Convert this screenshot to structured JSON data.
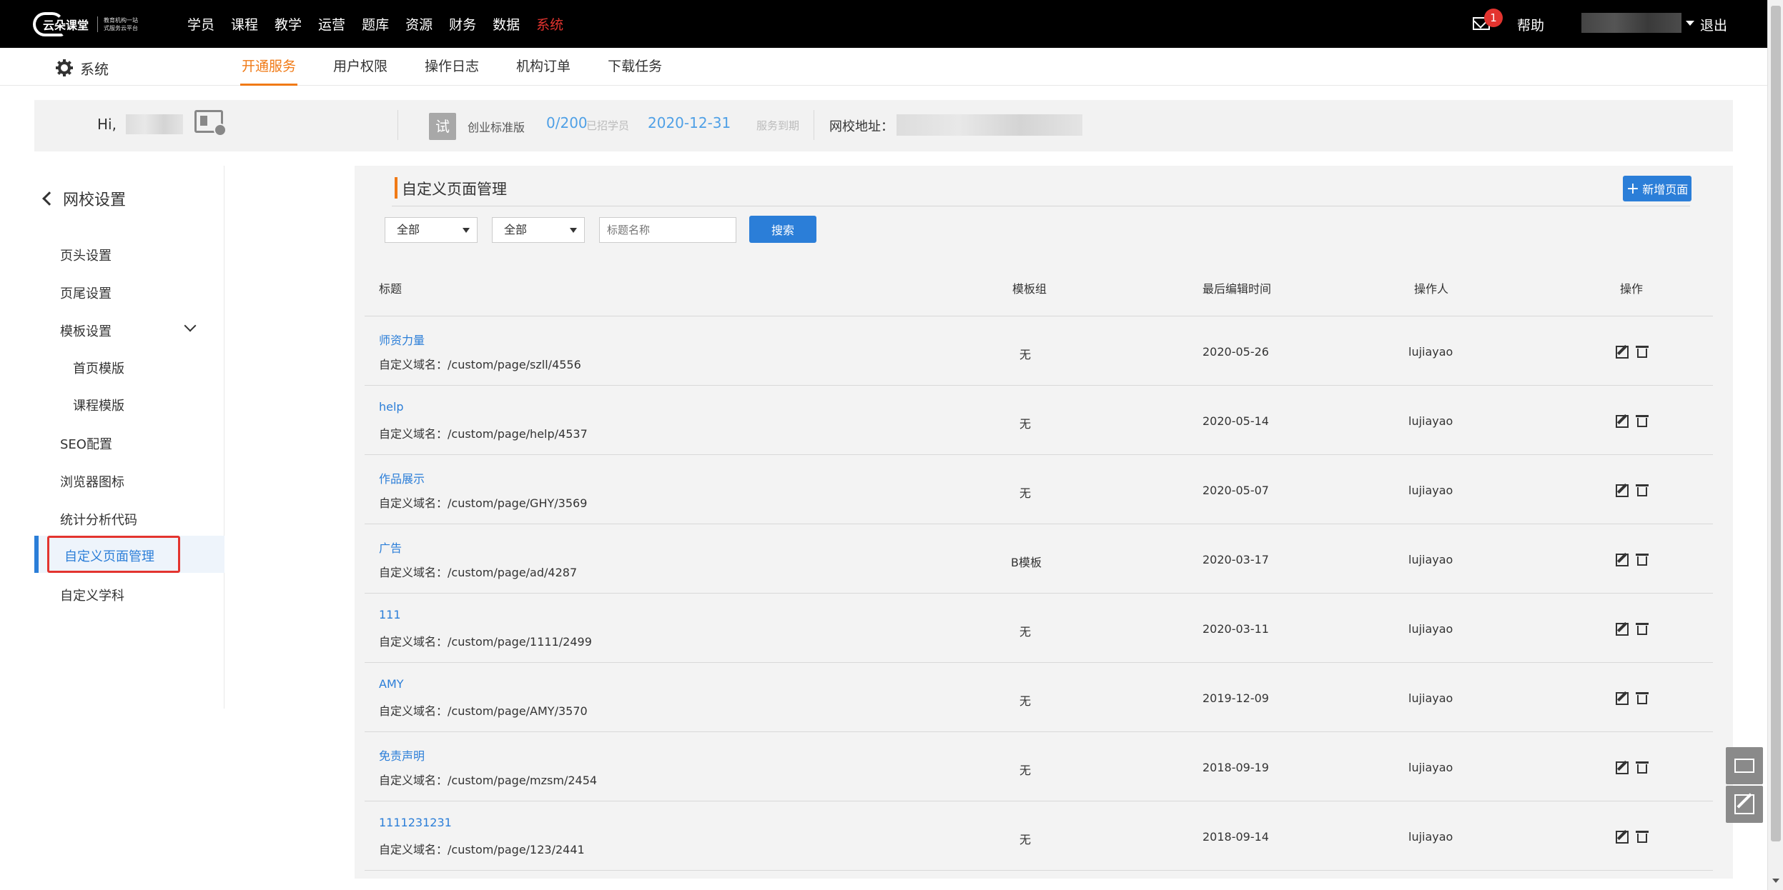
{
  "topbar": {
    "logo_text": "云朵课堂",
    "logo_sub": "教育机构一站式服务云平台",
    "nav": [
      "学员",
      "课程",
      "教学",
      "运营",
      "题库",
      "资源",
      "财务",
      "数据",
      "系统"
    ],
    "mail_count": "1",
    "help": "帮助",
    "logout": "退出"
  },
  "subbar": {
    "title": "系统",
    "tabs": [
      "开通服务",
      "用户权限",
      "操作日志",
      "机构订单",
      "下载任务"
    ]
  },
  "info": {
    "greeting": "Hi,",
    "trial_badge": "试",
    "plan": "创业标准版",
    "quota": "0/200",
    "quota_note": "已招学员",
    "expire_date": "2020-12-31",
    "expire_note": "服务到期",
    "school_url_label": "网校地址："
  },
  "sidebar": {
    "back": "网校设置",
    "items": [
      "页头设置",
      "页尾设置",
      "模板设置",
      "首页模版",
      "课程模版",
      "SEO配置",
      "浏览器图标",
      "统计分析代码",
      "自定义页面管理",
      "自定义学科"
    ]
  },
  "main": {
    "title": "自定义页面管理",
    "new_button": "新增页面",
    "filter1": "全部",
    "filter2": "全部",
    "search_placeholder": "标题名称",
    "search_button": "搜索",
    "columns": [
      "标题",
      "模板组",
      "最后编辑时间",
      "操作人",
      "操作"
    ],
    "rows": [
      {
        "title": "师资力量",
        "domain": "自定义域名：/custom/page/szll/4556",
        "group": "无",
        "date": "2020-05-26",
        "operator": "lujiayao"
      },
      {
        "title": "help",
        "domain": "自定义域名：/custom/page/help/4537",
        "group": "无",
        "date": "2020-05-14",
        "operator": "lujiayao"
      },
      {
        "title": "作品展示",
        "domain": "自定义域名：/custom/page/GHY/3569",
        "group": "无",
        "date": "2020-05-07",
        "operator": "lujiayao"
      },
      {
        "title": "广告",
        "domain": "自定义域名：/custom/page/ad/4287",
        "group": "B模板",
        "date": "2020-03-17",
        "operator": "lujiayao"
      },
      {
        "title": "111",
        "domain": "自定义域名：/custom/page/1111/2499",
        "group": "无",
        "date": "2020-03-11",
        "operator": "lujiayao"
      },
      {
        "title": "AMY",
        "domain": "自定义域名：/custom/page/AMY/3570",
        "group": "无",
        "date": "2019-12-09",
        "operator": "lujiayao"
      },
      {
        "title": "免责声明",
        "domain": "自定义域名：/custom/page/mzsm/2454",
        "group": "无",
        "date": "2018-09-19",
        "operator": "lujiayao"
      },
      {
        "title": "1111231231",
        "domain": "自定义域名：/custom/page/123/2441",
        "group": "无",
        "date": "2018-09-14",
        "operator": "lujiayao"
      }
    ]
  }
}
